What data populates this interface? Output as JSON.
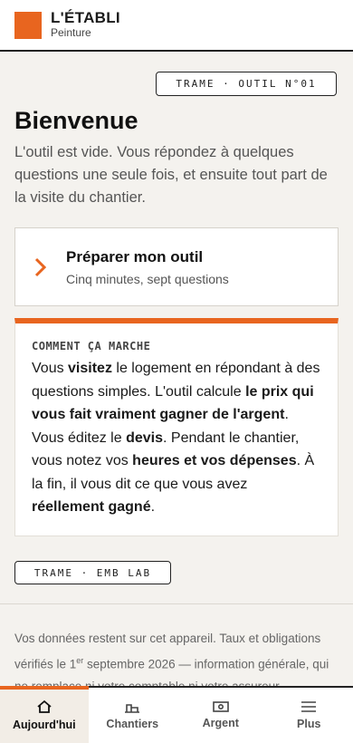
{
  "header": {
    "title": "L'ÉTABLI",
    "subtitle": "Peinture"
  },
  "main": {
    "tag_top": "TRAME · OUTIL N°01",
    "title": "Bienvenue",
    "intro": "L'outil est vide. Vous répondez à quelques questions une seule fois, et ensuite tout part de la visite du chantier.",
    "prepare_card": {
      "title": "Préparer mon outil",
      "subtitle": "Cinq minutes, sept questions"
    },
    "how_card": {
      "label": "COMMENT ÇA MARCHE",
      "p1": "Vous ",
      "b1": "visitez",
      "p2": " le logement en répondant à des questions simples. L'outil calcule ",
      "b2": "le prix qui vous fait vraiment gagner de l'argent",
      "p3": ". Vous éditez le ",
      "b3": "devis",
      "p4": ". Pendant le chantier, vous notez vos ",
      "b4": "heures et vos dépenses",
      "p5": ". À la fin, il vous dit ce que vous avez ",
      "b5": "réellement gagné",
      "p6": "."
    },
    "tag_bottom": "TRAME · EMB LAB",
    "footer": {
      "part1": "Vos données restent sur cet appareil. Taux et obligations vérifiés le 1",
      "sup": "er",
      "part2": " septembre 2026 — information générale, qui ne remplace ni votre comptable ni votre assureur."
    }
  },
  "tabbar": {
    "tabs": [
      {
        "label": "Aujourd'hui",
        "icon": "home-icon",
        "active": true
      },
      {
        "label": "Chantiers",
        "icon": "building-icon",
        "active": false
      },
      {
        "label": "Argent",
        "icon": "banknote-icon",
        "active": false
      },
      {
        "label": "Plus",
        "icon": "menu-icon",
        "active": false
      }
    ]
  },
  "colors": {
    "accent": "#e8651f",
    "background": "#f4f2ee",
    "text": "#1f1f1f"
  }
}
